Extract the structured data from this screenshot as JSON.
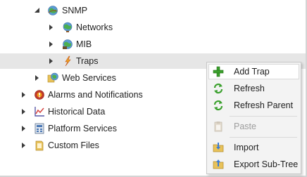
{
  "tree": {
    "snmp": {
      "label": "SNMP",
      "icon": "snmp-globe-icon",
      "expanded": true
    },
    "networks": {
      "label": "Networks",
      "icon": "globe-icon"
    },
    "mib": {
      "label": "MIB",
      "icon": "mib-globe-icon"
    },
    "traps": {
      "label": "Traps",
      "icon": "lightning-icon",
      "selected": true
    },
    "web_services": {
      "label": "Web Services",
      "icon": "web-services-icon"
    },
    "alarms": {
      "label": "Alarms and Notifications",
      "icon": "alarm-icon"
    },
    "historical": {
      "label": "Historical Data",
      "icon": "chart-icon"
    },
    "platform": {
      "label": "Platform Services",
      "icon": "platform-icon"
    },
    "custom_files": {
      "label": "Custom Files",
      "icon": "folder-icon"
    }
  },
  "context_menu": {
    "items": [
      {
        "label": "Add Trap",
        "icon": "add-icon",
        "enabled": true,
        "highlighted": true
      },
      {
        "label": "Refresh",
        "icon": "refresh-icon",
        "enabled": true
      },
      {
        "label": "Refresh Parent",
        "icon": "refresh-icon",
        "enabled": true
      },
      {
        "label": "Paste",
        "icon": "paste-icon",
        "enabled": false
      },
      {
        "label": "Import",
        "icon": "import-folder-icon",
        "enabled": true
      },
      {
        "label": "Export Sub-Tree",
        "icon": "export-folder-icon",
        "enabled": true
      }
    ]
  },
  "colors": {
    "selection": "#e6e6e6",
    "menu_background": "#f3f3f3",
    "disabled_text": "#9d9d9d",
    "add_green": "#3aa02c"
  }
}
